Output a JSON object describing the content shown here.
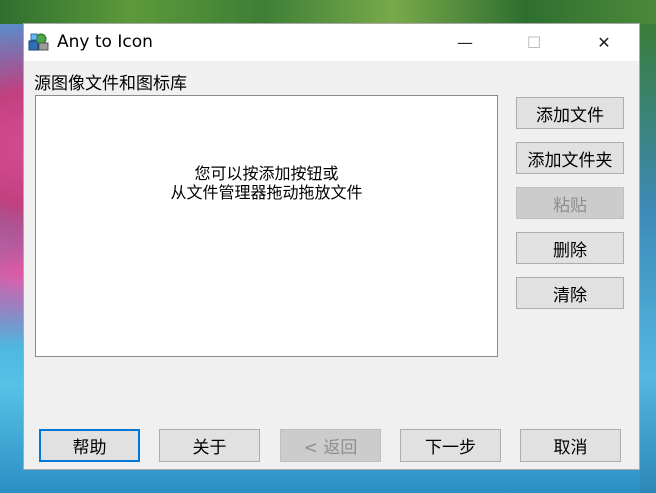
{
  "window": {
    "title": "Any to Icon",
    "controls": {
      "minimize": "—",
      "maximize": "☐",
      "close": "✕"
    }
  },
  "source": {
    "group_label": "源图像文件和图标库",
    "hint_line1": "您可以按添加按钮或",
    "hint_line2": "从文件管理器拖动拖放文件"
  },
  "side_buttons": {
    "add_file": "添加文件",
    "add_folder": "添加文件夹",
    "paste": "粘贴",
    "delete": "删除",
    "clear": "清除"
  },
  "bottom_buttons": {
    "help": "帮助",
    "about": "关于",
    "back": "< 返回",
    "next": "下一步",
    "cancel": "取消"
  },
  "icons": {
    "app": "app-icon"
  },
  "colors": {
    "window_bg": "#f0f0f0",
    "default_button_border": "#0078d7"
  }
}
